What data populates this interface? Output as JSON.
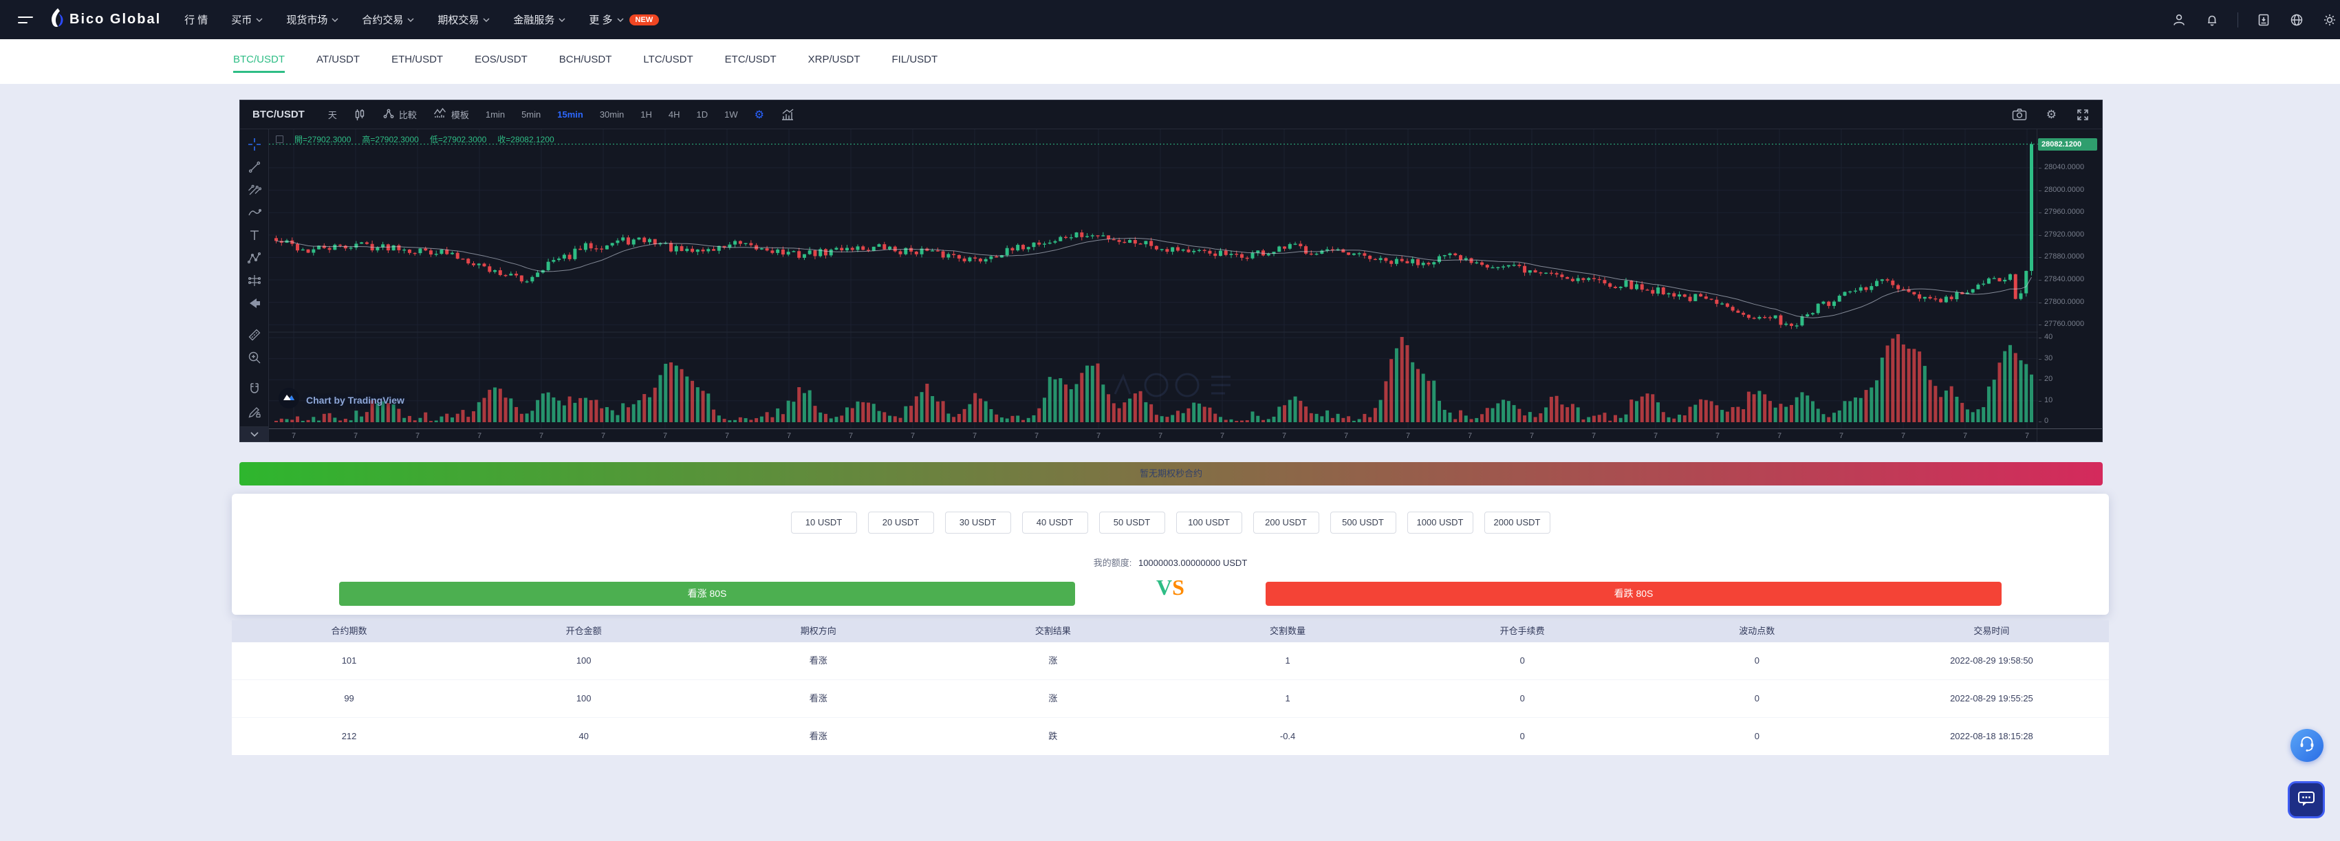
{
  "navbar": {
    "logo_text": "Bico Global",
    "menu": [
      {
        "label": "行 情",
        "caret": false
      },
      {
        "label": "买币",
        "caret": true
      },
      {
        "label": "现货市场",
        "caret": true
      },
      {
        "label": "合约交易",
        "caret": true
      },
      {
        "label": "期权交易",
        "caret": true
      },
      {
        "label": "金融服务",
        "caret": true
      },
      {
        "label": "更 多",
        "caret": true,
        "badge": "NEW"
      }
    ],
    "right_icons": [
      "user-icon",
      "bell-icon",
      "manual-icon",
      "globe-icon",
      "theme-icon"
    ]
  },
  "pair_tabs": {
    "active": "BTC/USDT",
    "tabs": [
      "BTC/USDT",
      "AT/USDT",
      "ETH/USDT",
      "EOS/USDT",
      "BCH/USDT",
      "LTC/USDT",
      "ETC/USDT",
      "XRP/USDT",
      "FIL/USDT"
    ]
  },
  "chart": {
    "symbol": "BTC/USDT",
    "toolbar": {
      "day_label": "天",
      "compare_label": "比較",
      "template_label": "模板",
      "intervals": [
        "1min",
        "5min",
        "15min",
        "30min",
        "1H",
        "4H",
        "1D",
        "1W"
      ],
      "active_interval": "15min"
    },
    "attribution": "Chart by TradingView"
  },
  "chart_data": {
    "type": "candlestick",
    "symbol": "BTC/USDT",
    "interval": "15min",
    "legend": {
      "open_label": "開",
      "high_label": "高",
      "low_label": "低",
      "close_label": "收",
      "open": "27902.3000",
      "high": "27902.3000",
      "low": "27902.3000",
      "close": "28082.1200"
    },
    "last_price_label": "28082.1200",
    "last_price": 28082.12,
    "price_ticks": [
      "28040.0000",
      "28000.0000",
      "27960.0000",
      "27920.0000",
      "27880.0000",
      "27840.0000",
      "27800.0000",
      "27760.0000"
    ],
    "volume_ticks": [
      "40",
      "30",
      "20",
      "10",
      "0"
    ],
    "time_tick_label": "7",
    "price_path": [
      [
        0,
        27908
      ],
      [
        0.02,
        27892
      ],
      [
        0.045,
        27903
      ],
      [
        0.07,
        27898
      ],
      [
        0.1,
        27886
      ],
      [
        0.125,
        27856
      ],
      [
        0.14,
        27838
      ],
      [
        0.155,
        27868
      ],
      [
        0.18,
        27902
      ],
      [
        0.21,
        27912
      ],
      [
        0.235,
        27888
      ],
      [
        0.26,
        27903
      ],
      [
        0.3,
        27884
      ],
      [
        0.33,
        27899
      ],
      [
        0.37,
        27890
      ],
      [
        0.4,
        27876
      ],
      [
        0.43,
        27903
      ],
      [
        0.46,
        27921
      ],
      [
        0.49,
        27908
      ],
      [
        0.52,
        27891
      ],
      [
        0.55,
        27881
      ],
      [
        0.58,
        27898
      ],
      [
        0.61,
        27885
      ],
      [
        0.64,
        27869
      ],
      [
        0.67,
        27881
      ],
      [
        0.7,
        27863
      ],
      [
        0.73,
        27849
      ],
      [
        0.76,
        27835
      ],
      [
        0.79,
        27819
      ],
      [
        0.82,
        27799
      ],
      [
        0.845,
        27773
      ],
      [
        0.865,
        27761
      ],
      [
        0.88,
        27793
      ],
      [
        0.9,
        27819
      ],
      [
        0.915,
        27839
      ],
      [
        0.93,
        27813
      ],
      [
        0.945,
        27801
      ],
      [
        0.96,
        27813
      ],
      [
        0.975,
        27837
      ],
      [
        0.99,
        27845
      ],
      [
        1,
        27856
      ]
    ],
    "volume_spikes": [
      [
        0.06,
        9
      ],
      [
        0.125,
        16
      ],
      [
        0.155,
        12
      ],
      [
        0.175,
        10
      ],
      [
        0.205,
        8
      ],
      [
        0.225,
        26
      ],
      [
        0.24,
        14
      ],
      [
        0.3,
        12
      ],
      [
        0.335,
        9
      ],
      [
        0.37,
        14
      ],
      [
        0.4,
        10
      ],
      [
        0.445,
        20
      ],
      [
        0.465,
        26
      ],
      [
        0.49,
        12
      ],
      [
        0.525,
        8
      ],
      [
        0.58,
        9
      ],
      [
        0.64,
        34
      ],
      [
        0.655,
        18
      ],
      [
        0.7,
        10
      ],
      [
        0.73,
        8
      ],
      [
        0.78,
        12
      ],
      [
        0.815,
        10
      ],
      [
        0.845,
        14
      ],
      [
        0.87,
        12
      ],
      [
        0.9,
        10
      ],
      [
        0.92,
        36
      ],
      [
        0.935,
        30
      ],
      [
        0.955,
        12
      ],
      [
        0.985,
        30
      ],
      [
        0.998,
        20
      ]
    ],
    "candle_count": 330
  },
  "banner": {
    "text": "暂无期权秒合约"
  },
  "order_panel": {
    "amounts": [
      "10 USDT",
      "20 USDT",
      "30 USDT",
      "40 USDT",
      "50 USDT",
      "100 USDT",
      "200 USDT",
      "500 USDT",
      "1000 USDT",
      "2000 USDT"
    ],
    "balance_label": "我的额度:",
    "balance_value": "10000003.00000000 USDT",
    "call_label": "看涨 80S",
    "put_label": "看跌 80S",
    "vs_v": "V",
    "vs_s": "S"
  },
  "orders_table": {
    "headers": [
      "合约期数",
      "开仓金额",
      "期权方向",
      "交割结果",
      "交割数量",
      "开仓手续费",
      "波动点数",
      "交易时间"
    ],
    "rows": [
      [
        "101",
        "100",
        "看涨",
        "涨",
        "1",
        "0",
        "0",
        "2022-08-29 19:58:50"
      ],
      [
        "99",
        "100",
        "看涨",
        "涨",
        "1",
        "0",
        "0",
        "2022-08-29 19:55:25"
      ],
      [
        "212",
        "40",
        "看涨",
        "跌",
        "-0.4",
        "0",
        "0",
        "2022-08-18 18:15:28"
      ]
    ]
  },
  "colors": {
    "up": "#2ebd85",
    "down": "#e2454a",
    "accent_blue": "#2962ff",
    "banner_from": "#2eb62e",
    "banner_to": "#d42a5c",
    "call_green": "#4caf50",
    "put_red": "#f44336",
    "badge": "#f04622"
  }
}
